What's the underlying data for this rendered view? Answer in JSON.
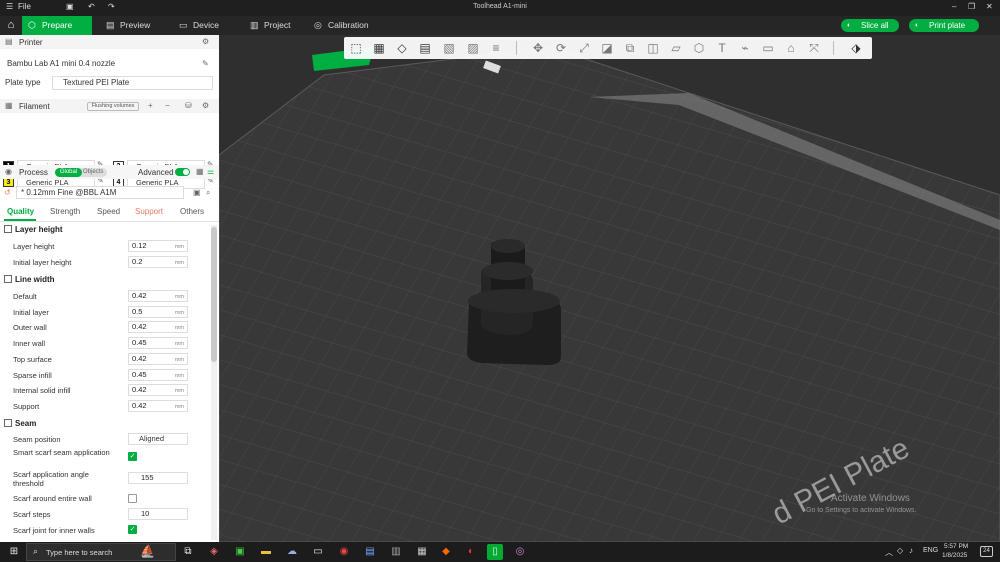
{
  "window": {
    "title": "Toolhead A1-mini",
    "file_menu": "File"
  },
  "nav": {
    "tabs": [
      {
        "label": "Prepare",
        "icon": "cube-icon"
      },
      {
        "label": "Preview",
        "icon": "preview-icon"
      },
      {
        "label": "Device",
        "icon": "device-icon"
      },
      {
        "label": "Project",
        "icon": "project-icon"
      },
      {
        "label": "Calibration",
        "icon": "calibration-icon"
      }
    ],
    "slice_label": "Slice all",
    "print_label": "Print plate"
  },
  "printer": {
    "section_label": "Printer",
    "name": "Bambu Lab A1 mini 0.4 nozzle",
    "plate_type_label": "Plate type",
    "plate_type": "Textured PEI Plate"
  },
  "filament": {
    "section_label": "Filament",
    "flushing_label": "Flushing volumes",
    "slots": [
      {
        "num": "1",
        "name": "Generic PLA",
        "color": "#000000",
        "text": "#ffffff"
      },
      {
        "num": "2",
        "name": "Generic PLA",
        "color": "#ffffff",
        "text": "#000000"
      },
      {
        "num": "3",
        "name": "Generic PLA",
        "color": "#f5ea1a",
        "text": "#000000"
      },
      {
        "num": "4",
        "name": "Generic PLA",
        "color": "#ffffff",
        "text": "#000000"
      }
    ]
  },
  "process": {
    "section_label": "Process",
    "global_label": "Global",
    "objects_label": "Objects",
    "advanced_label": "Advanced",
    "preset": "* 0.12mm Fine @BBL A1M",
    "tabs": [
      "Quality",
      "Strength",
      "Speed",
      "Support",
      "Others"
    ]
  },
  "quality": {
    "layer_height": {
      "title": "Layer height",
      "rows": [
        {
          "label": "Layer height",
          "value": "0.12",
          "unit": "mm"
        },
        {
          "label": "Initial layer height",
          "value": "0.2",
          "unit": "mm"
        }
      ]
    },
    "line_width": {
      "title": "Line width",
      "rows": [
        {
          "label": "Default",
          "value": "0.42",
          "unit": "mm"
        },
        {
          "label": "Initial layer",
          "value": "0.5",
          "unit": "mm"
        },
        {
          "label": "Outer wall",
          "value": "0.42",
          "unit": "mm"
        },
        {
          "label": "Inner wall",
          "value": "0.45",
          "unit": "mm"
        },
        {
          "label": "Top surface",
          "value": "0.42",
          "unit": "mm"
        },
        {
          "label": "Sparse infill",
          "value": "0.45",
          "unit": "mm"
        },
        {
          "label": "Internal solid infill",
          "value": "0.42",
          "unit": "mm"
        },
        {
          "label": "Support",
          "value": "0.42",
          "unit": "mm"
        }
      ]
    },
    "seam": {
      "title": "Seam",
      "position_label": "Seam position",
      "position_value": "Aligned",
      "smart_scarf_label": "Smart scarf seam application",
      "smart_scarf": true,
      "angle_label": "Scarf application angle threshold",
      "angle_value": "155",
      "around_label": "Scarf around entire wall",
      "around": false,
      "steps_label": "Scarf steps",
      "steps_value": "10",
      "inner_label": "Scarf joint for inner walls",
      "inner": true
    }
  },
  "viewport": {
    "plate_text": "d PEI Plate",
    "watermark_title": "Activate Windows",
    "watermark_sub": "Go to Settings to activate Windows."
  },
  "taskbar": {
    "search_placeholder": "Type here to search",
    "language": "ENG",
    "time": "5:57 PM",
    "date": "1/8/2025",
    "notif_count": "24"
  },
  "colors": {
    "accent": "#00ae42"
  }
}
